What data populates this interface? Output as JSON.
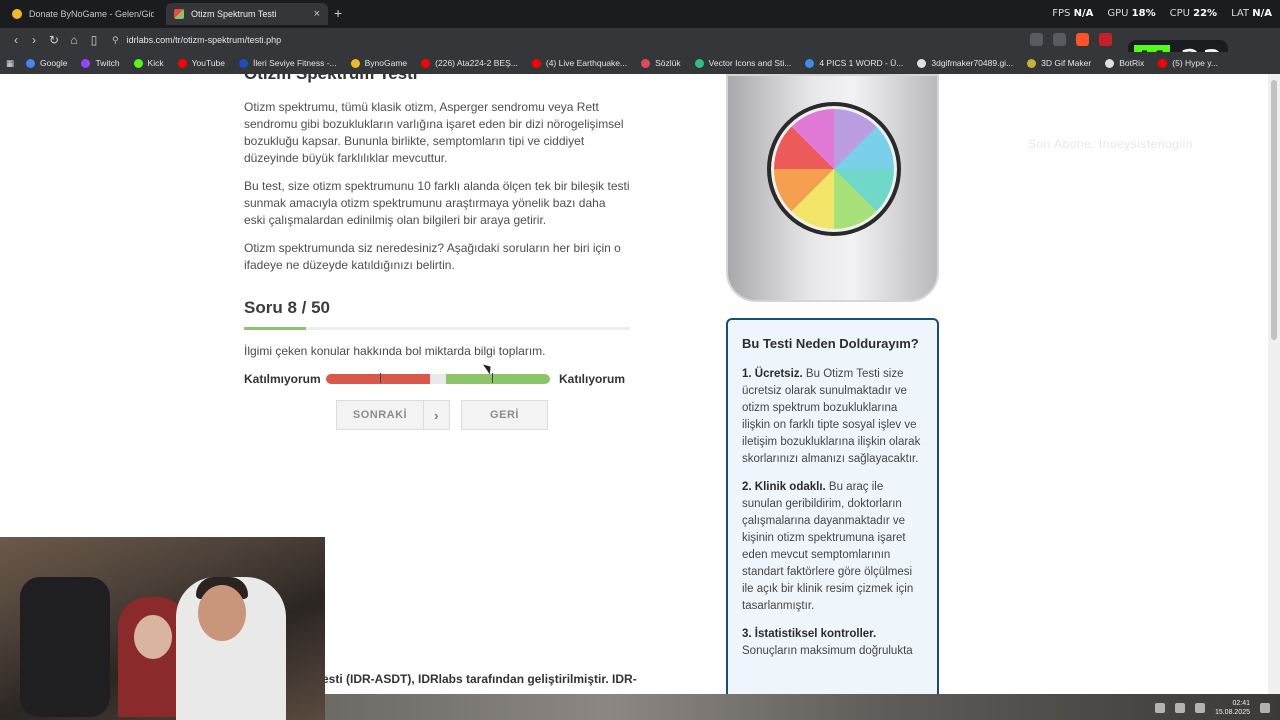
{
  "browser": {
    "tabs": [
      {
        "title": "Donate ByNoGame - Gelen/Giden Ba",
        "active": false
      },
      {
        "title": "Otizm Spektrum Testi",
        "active": true
      }
    ],
    "new_tab": "+",
    "tab_close": "×",
    "url": "idrlabs.com/tr/otizm-spektrum/testi.php",
    "overlay": {
      "fps_label": "FPS",
      "fps_value": "N/A",
      "gpu_label": "GPU",
      "gpu_value": "18%",
      "cpu_label": "CPU",
      "cpu_value": "22%",
      "lat_label": "LAT",
      "lat_value": "N/A"
    },
    "bookmarks": [
      {
        "label": "Google",
        "color": "#4285f4"
      },
      {
        "label": "Twitch",
        "color": "#9146ff"
      },
      {
        "label": "Kick",
        "color": "#53fc18"
      },
      {
        "label": "YouTube",
        "color": "#ff0000"
      },
      {
        "label": "İleri Seviye Fitness -...",
        "color": "#1b4fbf"
      },
      {
        "label": "BynoGame",
        "color": "#f1b92c"
      },
      {
        "label": "(226) Ata224-2 BEŞ...",
        "color": "#ff0000"
      },
      {
        "label": "(4) Live Earthquake...",
        "color": "#ff0000"
      },
      {
        "label": "Sözlük",
        "color": "#e04a5a"
      },
      {
        "label": "Vector Icons and Sti...",
        "color": "#2ec27e"
      },
      {
        "label": "4 PICS 1 WORD - Ü...",
        "color": "#3a8ee6"
      },
      {
        "label": "3dgifmaker70489.gi...",
        "color": "#e0e0e0"
      },
      {
        "label": "3D Gif Maker",
        "color": "#c8b13a"
      },
      {
        "label": "BotRix",
        "color": "#e0e0e0"
      },
      {
        "label": "(5) Hype y...",
        "color": "#ff0000"
      }
    ],
    "kick_badge": {
      "letter": "K",
      "number": "23"
    }
  },
  "page": {
    "cut_title": "Otizm Spektrum Testi",
    "paragraphs": [
      "Otizm spektrumu, tümü klasik otizm, Asperger sendromu veya Rett sendromu gibi bozuklukların varlığına işaret eden bir dizi nörogelişimsel bozukluğu kapsar. Bununla birlikte, semptomların tipi ve ciddiyet düzeyinde büyük farklılıklar mevcuttur.",
      "Bu test, size otizm spektrumunu 10 farklı alanda ölçen tek bir bileşik testi sunmak amacıyla otizm spektrumunu araştırmaya yönelik bazı daha eski çalışmalardan edinilmiş olan bilgileri bir araya getirir.",
      "Otizm spektrumunda siz neredesiniz? Aşağıdaki soruların her biri için o ifadeye ne düzeyde katıldığınızı belirtin."
    ],
    "question_counter": "Soru 8 / 50",
    "progress": 0.16,
    "question_text": "İlgimi çeken konular hakkında bol miktarda bilgi toplarım.",
    "scale_left": "Katılmıyorum",
    "scale_right": "Katılıyorum",
    "next_button": "SONRAKİ",
    "next_arrow": "›",
    "back_button": "GERİ",
    "footer_text": "esti (IDR-ASDT), IDRlabs tarafından geliştirilmiştir. IDR-",
    "watermark": "Son Abone: Inoeysistenogiin",
    "sidebar": {
      "title": "Bu Testi Neden Doldurayım?",
      "items": [
        {
          "heading": "1. Ücretsiz.",
          "text": " Bu Otizm Testi size ücretsiz olarak sunulmaktadır ve otizm spektrum bozukluklarına ilişkin on farklı tipte sosyal işlev ve iletişim bozukluklarına ilişkin olarak skorlarınızı almanızı sağlayacaktır."
        },
        {
          "heading": "2. Klinik odaklı.",
          "text": " Bu araç ile sunulan geribildirim, doktorların çalışmalarına dayanmaktadır ve kişinin otizm spektrumuna işaret eden mevcut semptomlarının standart faktörlere göre ölçülmesi ile açık bir klinik resim çizmek için tasarlanmıştır."
        },
        {
          "heading": "3. İstatistiksel kontroller.",
          "text": " Sonuçların maksimum doğrulukta"
        }
      ]
    }
  },
  "taskbar": {
    "time": "02:41",
    "date": "15.08.2025"
  }
}
